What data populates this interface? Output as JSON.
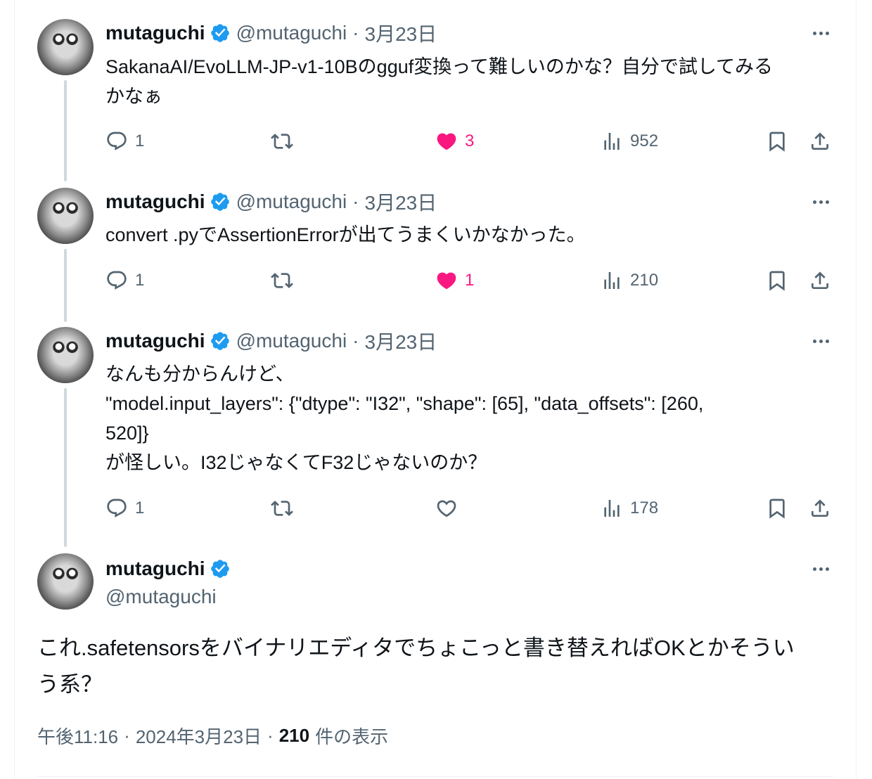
{
  "colors": {
    "verified": "#1d9bf0",
    "like_active": "#f91880",
    "secondary_text": "#536471",
    "thread_line": "#cfd9de"
  },
  "thread": [
    {
      "name": "mutaguchi",
      "handle": "@mutaguchi",
      "separator": "·",
      "date": "3月23日",
      "text": "SakanaAI/EvoLLM-JP-v1-10Bのgguf変換って難しいのかな？自分で試してみる\nかなぁ",
      "replies": "1",
      "retweets": "",
      "likes": "3",
      "liked": true,
      "views": "952"
    },
    {
      "name": "mutaguchi",
      "handle": "@mutaguchi",
      "separator": "·",
      "date": "3月23日",
      "text": "convert .pyでAssertionErrorが出てうまくいかなかった。",
      "replies": "1",
      "retweets": "",
      "likes": "1",
      "liked": true,
      "views": "210"
    },
    {
      "name": "mutaguchi",
      "handle": "@mutaguchi",
      "separator": "·",
      "date": "3月23日",
      "text": "なんも分からんけど、\n\"model.input_layers\": {\"dtype\": \"I32\", \"shape\": [65], \"data_offsets\": [260,\n520]}\nが怪しい。I32じゃなくてF32じゃないのか？",
      "replies": "1",
      "retweets": "",
      "likes": "",
      "liked": false,
      "views": "178"
    }
  ],
  "main_tweet": {
    "name": "mutaguchi",
    "handle": "@mutaguchi",
    "text": "これ.safetensorsをバイナリエディタでちょこっと書き替えればOKとかそうい\nう系？",
    "time": "午後11:16",
    "separator": "·",
    "date": "2024年3月23日",
    "views_count": "210",
    "views_label": "件の表示"
  }
}
